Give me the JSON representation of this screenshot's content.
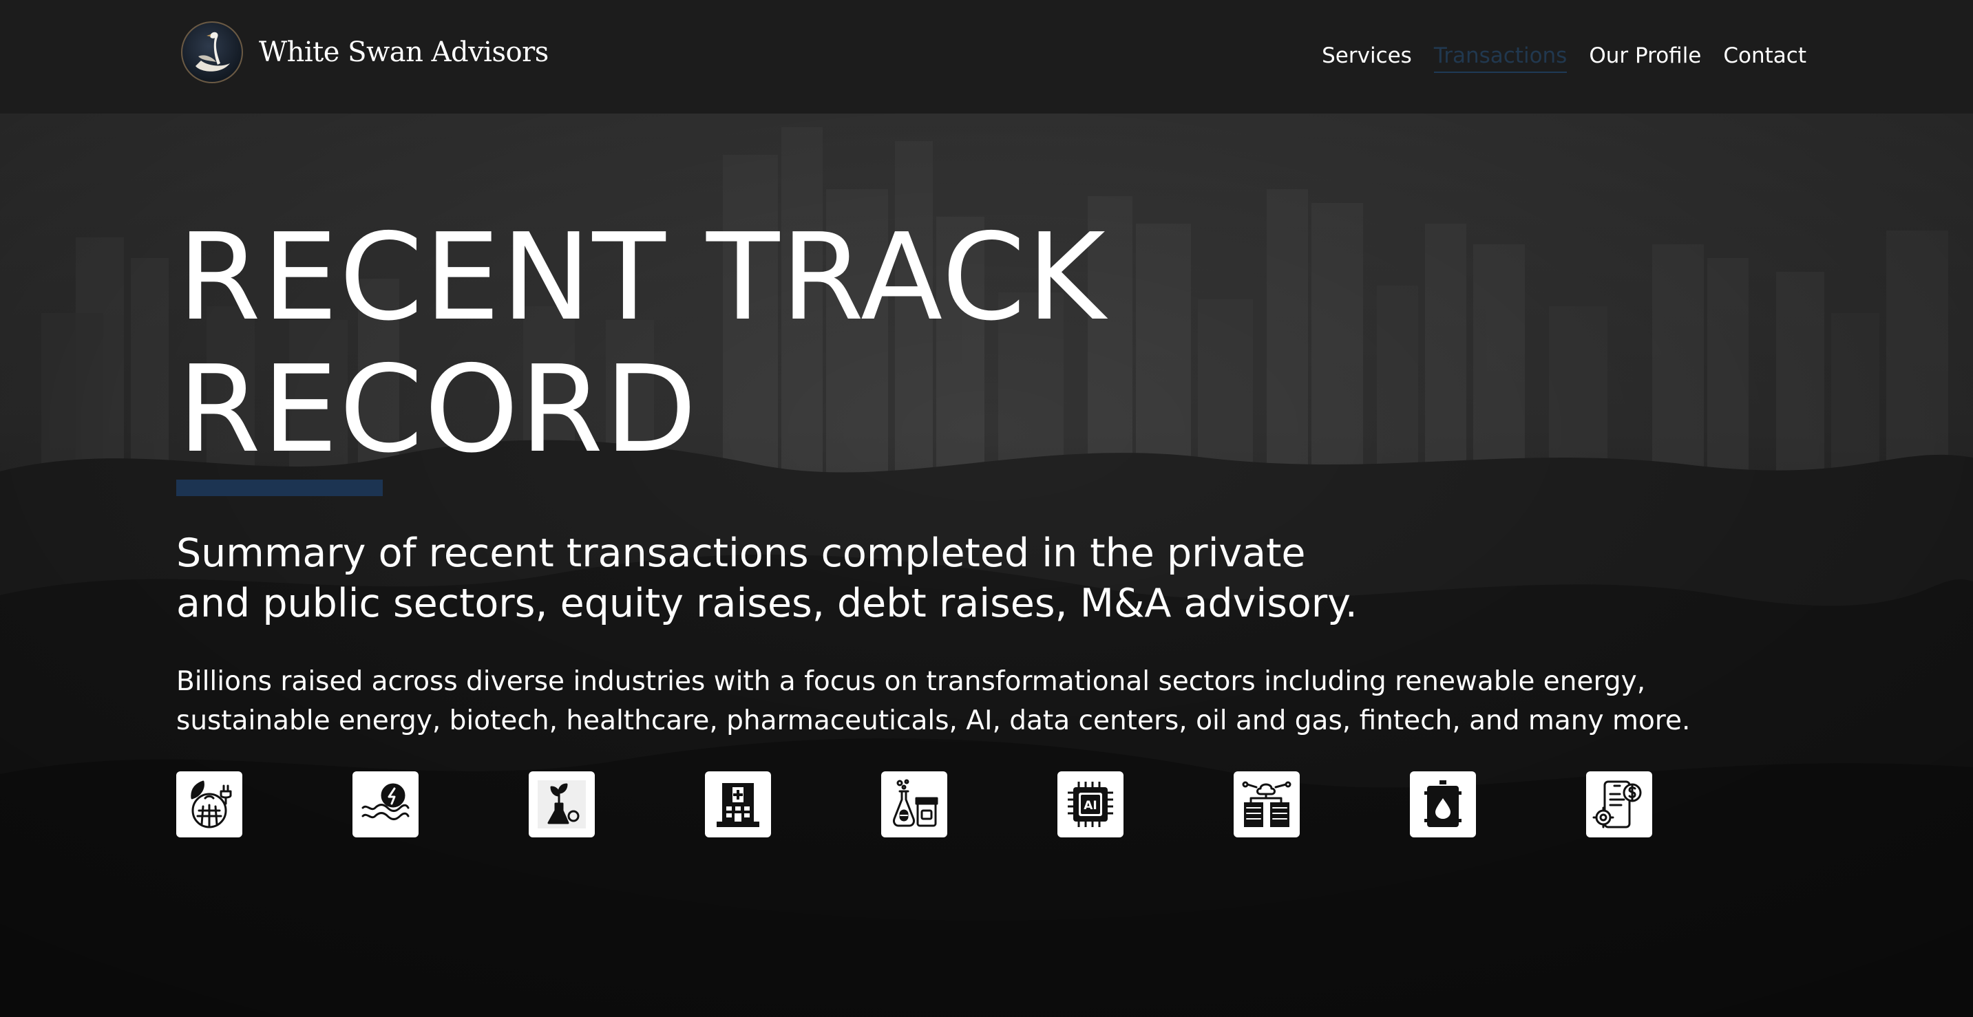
{
  "header": {
    "brand_name": "White Swan Advisors",
    "logo_icon": "swan-logo-icon",
    "nav": [
      {
        "label": "Services",
        "active": false
      },
      {
        "label": "Transactions",
        "active": true
      },
      {
        "label": "Our Profile",
        "active": false
      },
      {
        "label": "Contact",
        "active": false
      }
    ]
  },
  "hero": {
    "title_line1": "RECENT TRACK",
    "title_line2": "RECORD",
    "subtitle_line1": "Summary of recent transactions completed in the private",
    "subtitle_line2": "and public sectors, equity raises, debt raises, M&A advisory.",
    "description_line1": "Billions raised across diverse industries with a focus on transformational sectors including renewable energy,",
    "description_line2": "sustainable energy, biotech, healthcare, pharmaceuticals, AI, data centers, oil and gas, fintech, and many more.",
    "sector_icons": [
      "renewable-energy-icon",
      "sustainable-energy-icon",
      "biotech-icon",
      "healthcare-icon",
      "pharmaceuticals-icon",
      "ai-chip-icon",
      "data-centers-icon",
      "oil-and-gas-icon",
      "fintech-icon"
    ],
    "chip_label": "AI"
  },
  "colors": {
    "header_bg": "#1c1c1c",
    "accent": "#1c3452",
    "active_nav": "#21384f",
    "text": "#ffffff"
  }
}
